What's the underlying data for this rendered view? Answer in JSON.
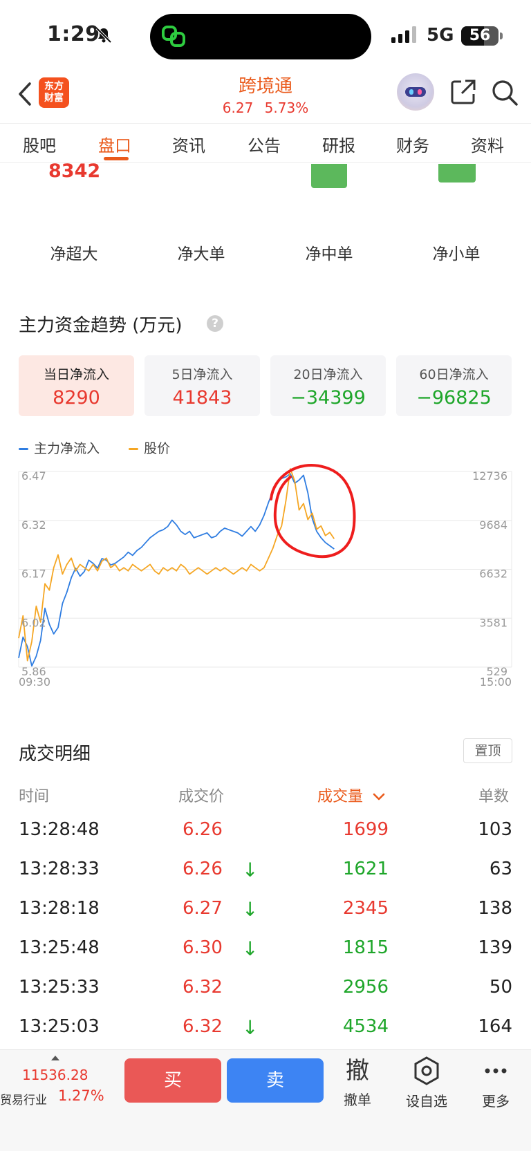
{
  "status_bar": {
    "time": "1:29",
    "network": "5G",
    "battery": "56"
  },
  "header": {
    "title": "跨境通",
    "price": "6.27",
    "change_pct": "5.73%",
    "logo_line1": "东方",
    "logo_line2": "财富"
  },
  "tabs": [
    {
      "label": "股吧"
    },
    {
      "label": "盘口"
    },
    {
      "label": "资讯"
    },
    {
      "label": "公告"
    },
    {
      "label": "研报"
    },
    {
      "label": "财务"
    },
    {
      "label": "资料"
    }
  ],
  "active_tab": "盘口",
  "net_flow": {
    "top_value": "8342",
    "labels": [
      "净超大",
      "净大单",
      "净中单",
      "净小单"
    ]
  },
  "trend": {
    "title": "主力资金趋势 (万元)",
    "help": "?",
    "cards": [
      {
        "label": "当日净流入",
        "value": "8290",
        "color": "#e8392f"
      },
      {
        "label": "5日净流入",
        "value": "41843",
        "color": "#e8392f"
      },
      {
        "label": "20日净流入",
        "value": "−34399",
        "color": "#1ea62a"
      },
      {
        "label": "60日净流入",
        "value": "−96825",
        "color": "#1ea62a"
      }
    ]
  },
  "chart_data": {
    "type": "line",
    "x_range": [
      "09:30",
      "15:00"
    ],
    "left_axis": {
      "ticks": [
        "6.47",
        "6.32",
        "6.17",
        "6.02",
        "5.86"
      ]
    },
    "right_axis": {
      "ticks": [
        "12736",
        "9684",
        "6632",
        "3581",
        "529"
      ]
    },
    "series": [
      {
        "name": "主力净流入",
        "color": "#2f7de1",
        "axis": "right",
        "values": [
          1100,
          2400,
          1800,
          600,
          1200,
          2200,
          4200,
          3200,
          2600,
          3000,
          4500,
          5200,
          6100,
          6700,
          6200,
          6500,
          7200,
          7000,
          6700,
          7300,
          7200,
          6900,
          7000,
          7200,
          7400,
          7700,
          7500,
          7800,
          8000,
          8300,
          8600,
          8800,
          9000,
          9100,
          9300,
          9700,
          9400,
          9000,
          8800,
          9000,
          8600,
          8700,
          8800,
          8900,
          8600,
          8700,
          9000,
          9200,
          9100,
          9000,
          8900,
          8700,
          9000,
          9300,
          9000,
          9400,
          10000,
          10800,
          11500,
          12100,
          12300,
          12400,
          12600,
          12000,
          12200,
          12500,
          11400,
          9800,
          9000,
          8600,
          8300,
          8100,
          7900
        ]
      },
      {
        "name": "股价",
        "color": "#f5a623",
        "axis": "left",
        "values": [
          5.95,
          6.02,
          5.88,
          5.94,
          6.05,
          6.0,
          6.12,
          6.1,
          6.17,
          6.21,
          6.15,
          6.18,
          6.2,
          6.16,
          6.18,
          6.17,
          6.16,
          6.18,
          6.16,
          6.19,
          6.2,
          6.17,
          6.18,
          6.16,
          6.17,
          6.16,
          6.18,
          6.17,
          6.16,
          6.17,
          6.18,
          6.16,
          6.15,
          6.17,
          6.16,
          6.17,
          6.16,
          6.18,
          6.17,
          6.15,
          6.16,
          6.17,
          6.16,
          6.15,
          6.16,
          6.17,
          6.16,
          6.17,
          6.16,
          6.15,
          6.16,
          6.17,
          6.16,
          6.18,
          6.17,
          6.16,
          6.17,
          6.2,
          6.23,
          6.27,
          6.3,
          6.38,
          6.48,
          6.44,
          6.35,
          6.37,
          6.32,
          6.34,
          6.29,
          6.3,
          6.27,
          6.28,
          6.26
        ]
      }
    ]
  },
  "trades": {
    "title": "成交明细",
    "pin_label": "置顶",
    "headers": {
      "time": "时间",
      "price": "成交价",
      "volume": "成交量",
      "count": "单数"
    },
    "rows": [
      {
        "time": "13:28:48",
        "price": "6.26",
        "arrow": "",
        "volume": "1699",
        "vol_color": "#e8392f",
        "count": "103"
      },
      {
        "time": "13:28:33",
        "price": "6.26",
        "arrow": "↓",
        "volume": "1621",
        "vol_color": "#1ea62a",
        "count": "63"
      },
      {
        "time": "13:28:18",
        "price": "6.27",
        "arrow": "↓",
        "volume": "2345",
        "vol_color": "#e8392f",
        "count": "138"
      },
      {
        "time": "13:25:48",
        "price": "6.30",
        "arrow": "↓",
        "volume": "1815",
        "vol_color": "#1ea62a",
        "count": "139"
      },
      {
        "time": "13:25:33",
        "price": "6.32",
        "arrow": "",
        "volume": "2956",
        "vol_color": "#1ea62a",
        "count": "50"
      },
      {
        "time": "13:25:03",
        "price": "6.32",
        "arrow": "↓",
        "volume": "4534",
        "vol_color": "#1ea62a",
        "count": "164"
      }
    ]
  },
  "bottom_bar": {
    "index_value": "11536.28",
    "index_name": "贸易行业",
    "index_pct": "1.27%",
    "buy": "买",
    "sell": "卖",
    "cancel_big": "撤",
    "cancel_label": "撤单",
    "watch_label": "设自选",
    "more_label": "更多"
  }
}
